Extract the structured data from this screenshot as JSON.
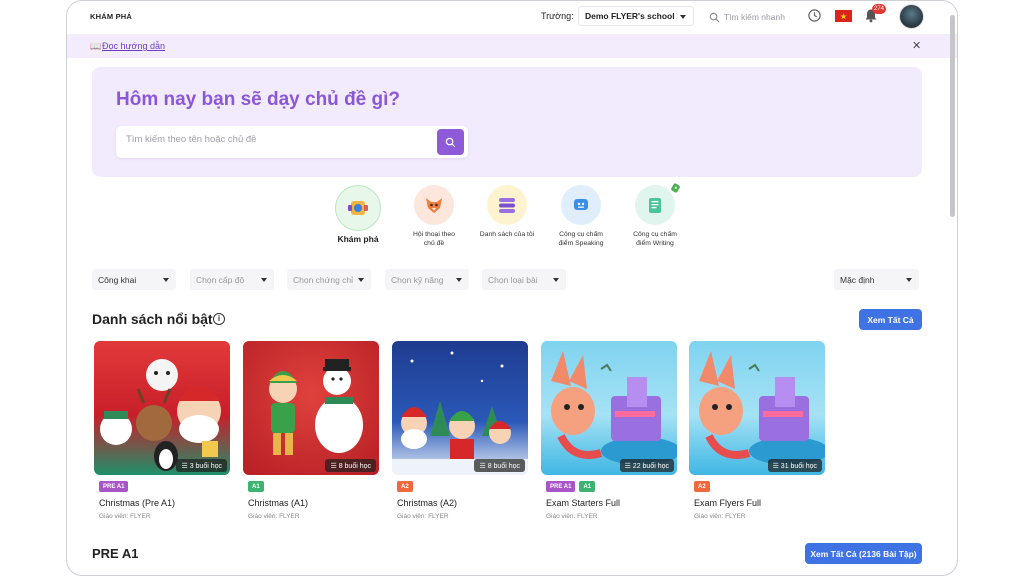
{
  "header": {
    "brand": "KHÁM PHÁ",
    "school_label": "Trường:",
    "school_value": "Demo FLYER's school",
    "search_placeholder": "Tìm kiếm nhanh",
    "notification_count": "274"
  },
  "guide": {
    "link_label": "Đọc hướng dẫn",
    "close": "✕"
  },
  "hero": {
    "title": "Hôm nay bạn sẽ dạy chủ đề gì?",
    "search_placeholder": "Tìm kiếm theo tên hoặc chủ đề"
  },
  "tools": [
    {
      "label": "Khám phá"
    },
    {
      "label": "Hội thoại theo chủ đề"
    },
    {
      "label": "Danh sách của tôi"
    },
    {
      "label": "Công cụ chấm điểm Speaking"
    },
    {
      "label": "Công cụ chấm điểm Writing"
    }
  ],
  "filters": [
    {
      "label": "Công khai"
    },
    {
      "label": "Chọn cấp độ"
    },
    {
      "label": "Chọn chứng chỉ"
    },
    {
      "label": "Chọn kỹ năng"
    },
    {
      "label": "Chọn loại bài"
    },
    {
      "label": "Mặc định"
    }
  ],
  "featured": {
    "title": "Danh sách nổi bật",
    "see_all": "Xem Tất Cả",
    "cards": [
      {
        "title": "Christmas (Pre A1)",
        "teacher": "Giáo viên: FLYER",
        "sessions": "3 buổi học",
        "tags": [
          "PRE A1"
        ]
      },
      {
        "title": "Christmas (A1)",
        "teacher": "Giáo viên: FLYER",
        "sessions": "8 buổi học",
        "tags": [
          "A1"
        ]
      },
      {
        "title": "Christmas (A2)",
        "teacher": "Giáo viên: FLYER",
        "sessions": "8 buổi học",
        "tags": [
          "A2"
        ]
      },
      {
        "title": "Exam Starters Full",
        "teacher": "Giáo viên: FLYER",
        "sessions": "22 buổi học",
        "tags": [
          "PRE A1",
          "A1"
        ]
      },
      {
        "title": "Exam Flyers Full",
        "teacher": "Giáo viên: FLYER",
        "sessions": "31 buổi học",
        "tags": [
          "A2"
        ]
      }
    ]
  },
  "pre_a1": {
    "title": "PRE A1",
    "see_all": "Xem Tất Cả (2136 Bài Tập)"
  },
  "colors": {
    "accent": "#8e5ad8",
    "button_blue": "#3f73e3",
    "tag_pre_a1": "#a855c8",
    "tag_a1": "#3cb371",
    "tag_a2": "#f0683c"
  }
}
